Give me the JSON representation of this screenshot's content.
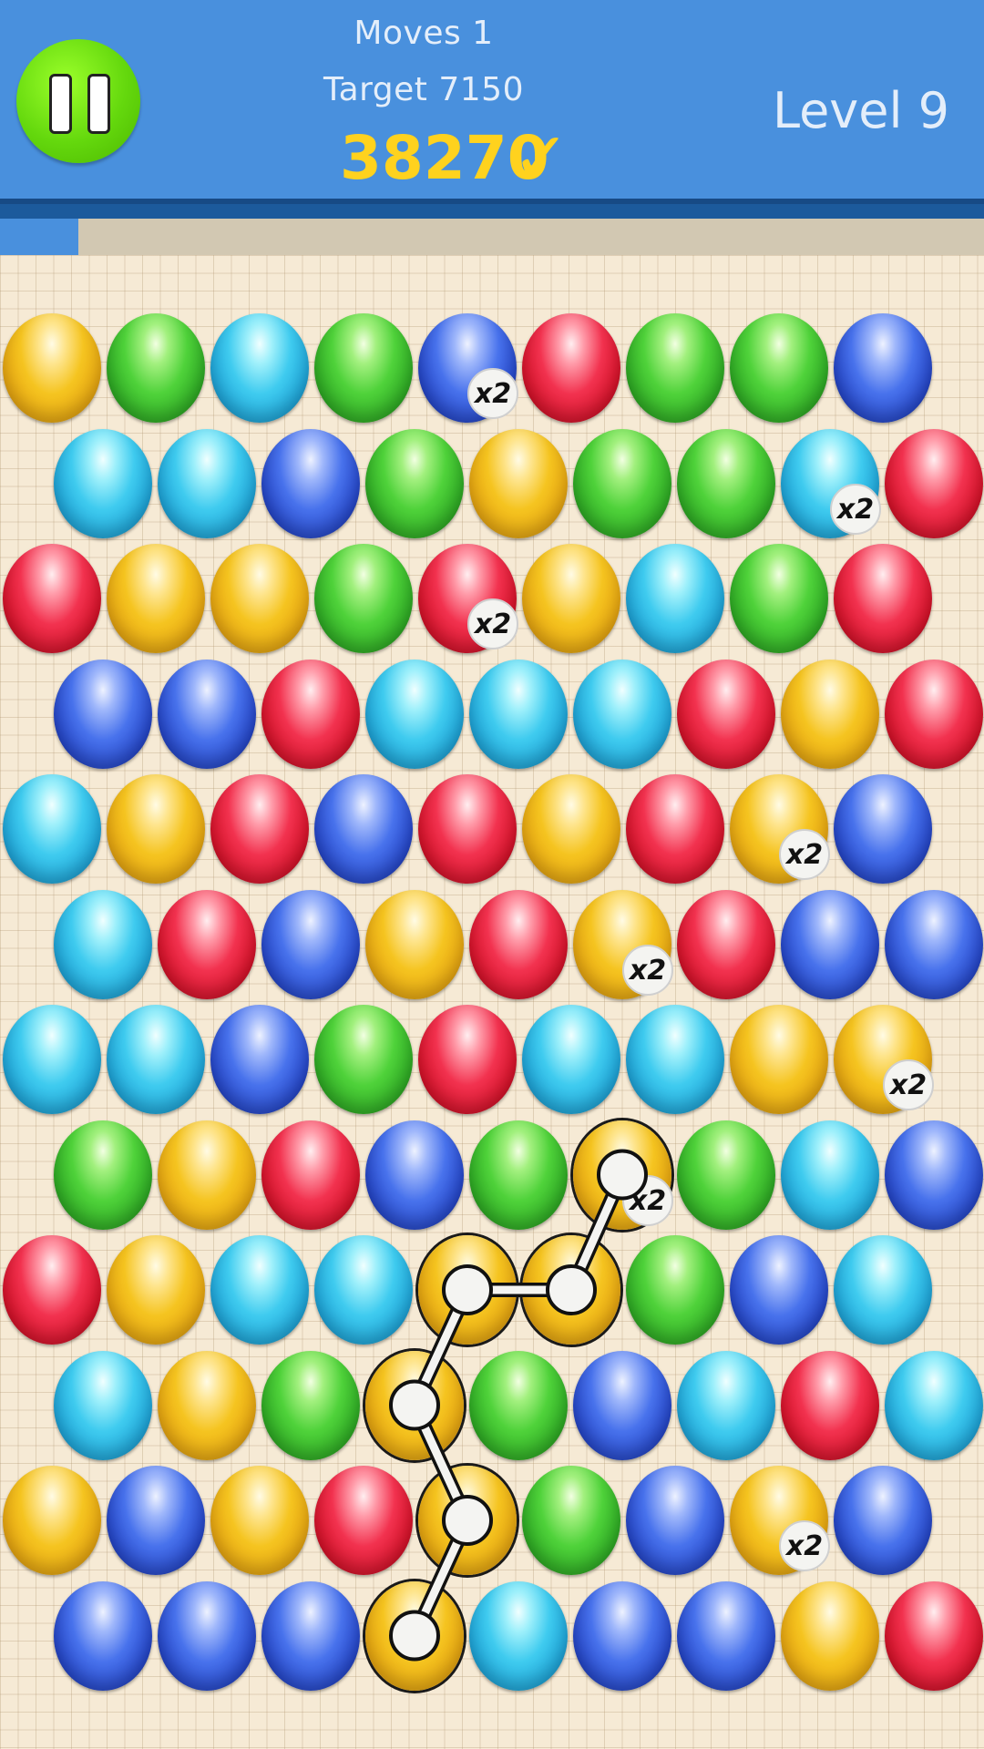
{
  "hud": {
    "moves": "Moves 1",
    "target": "Target 7150",
    "score": "38270",
    "score_check": "✓",
    "level": "Level 9",
    "pause_icon": "pause-icon",
    "progress_fraction": 0.08
  },
  "colors": {
    "header": "#4990dd",
    "pause_button": "#64d80d",
    "score": "#ffd21e",
    "board": "#f6ead5"
  },
  "board": {
    "rows": [
      [
        "yellow",
        "green",
        "cyan",
        "green",
        "blue",
        "red",
        "green",
        "green",
        "blue"
      ],
      [
        "cyan",
        "cyan",
        "blue",
        "green",
        "yellow",
        "green",
        "green",
        "cyan",
        "red"
      ],
      [
        "red",
        "yellow",
        "yellow",
        "green",
        "red",
        "yellow",
        "cyan",
        "green",
        "red"
      ],
      [
        "blue",
        "blue",
        "red",
        "cyan",
        "cyan",
        "cyan",
        "red",
        "yellow",
        "red"
      ],
      [
        "cyan",
        "yellow",
        "red",
        "blue",
        "red",
        "yellow",
        "red",
        "yellow",
        "blue"
      ],
      [
        "cyan",
        "red",
        "blue",
        "yellow",
        "red",
        "yellow",
        "red",
        "blue",
        "blue"
      ],
      [
        "cyan",
        "cyan",
        "blue",
        "green",
        "red",
        "cyan",
        "cyan",
        "yellow",
        "yellow"
      ],
      [
        "green",
        "yellow",
        "red",
        "blue",
        "green",
        "yellow",
        "green",
        "cyan",
        "blue"
      ],
      [
        "red",
        "yellow",
        "cyan",
        "cyan",
        "yellow",
        "yellow",
        "green",
        "blue",
        "cyan"
      ],
      [
        "cyan",
        "yellow",
        "green",
        "yellow",
        "green",
        "blue",
        "cyan",
        "red",
        "cyan"
      ],
      [
        "yellow",
        "blue",
        "yellow",
        "red",
        "yellow",
        "green",
        "blue",
        "yellow",
        "blue"
      ],
      [
        "blue",
        "blue",
        "blue",
        "yellow",
        "cyan",
        "blue",
        "blue",
        "yellow",
        "red"
      ]
    ],
    "multiplier_label": "x2",
    "multipliers": [
      [
        0,
        4
      ],
      [
        1,
        7
      ],
      [
        2,
        4
      ],
      [
        4,
        7
      ],
      [
        5,
        5
      ],
      [
        6,
        8
      ],
      [
        7,
        5
      ],
      [
        10,
        7
      ]
    ],
    "selected_path": [
      [
        7,
        5
      ],
      [
        8,
        5
      ],
      [
        8,
        4
      ],
      [
        9,
        3
      ],
      [
        10,
        4
      ],
      [
        11,
        3
      ]
    ]
  }
}
